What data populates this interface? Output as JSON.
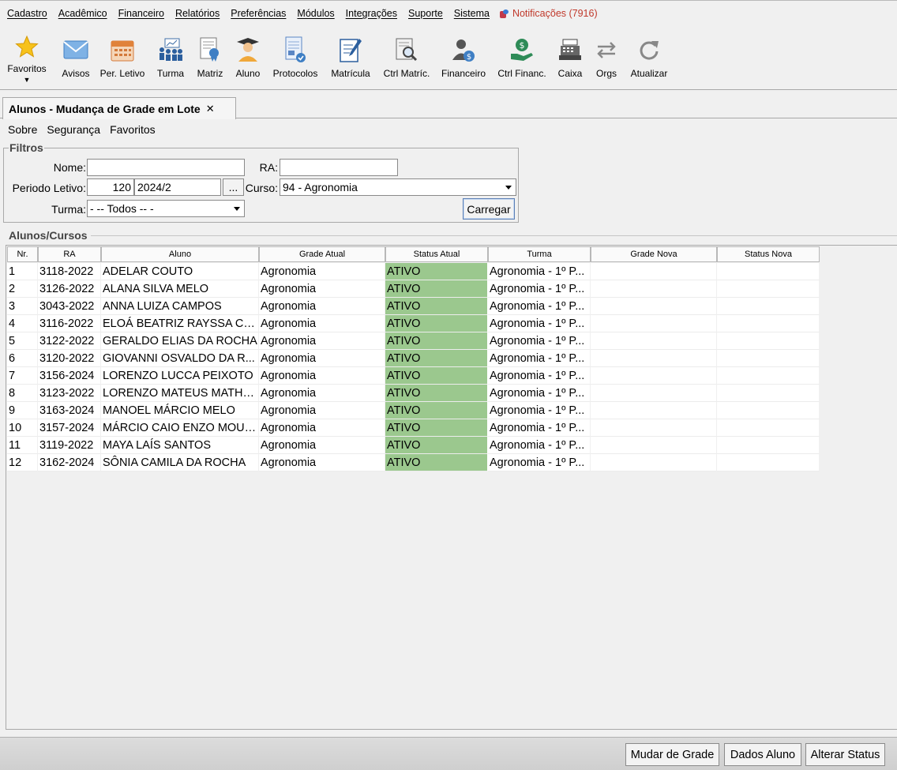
{
  "menu": {
    "items": [
      "Cadastro",
      "Acadêmico",
      "Financeiro",
      "Relatórios",
      "Preferências",
      "Módulos",
      "Integrações",
      "Suporte",
      "Sistema"
    ],
    "notifications": "Notificações (7916)"
  },
  "toolbar": {
    "favoritos": "Favoritos",
    "avisos": "Avisos",
    "per_letivo": "Per. Letivo",
    "turma": "Turma",
    "matriz": "Matriz",
    "aluno": "Aluno",
    "protocolos": "Protocolos",
    "matricula": "Matrícula",
    "ctrl_matric": "Ctrl Matríc.",
    "financeiro": "Financeiro",
    "ctrl_financ": "Ctrl Financ.",
    "caixa": "Caixa",
    "orgs": "Orgs",
    "atualizar": "Atualizar"
  },
  "tab": {
    "title": "Alunos - Mudança de Grade em Lote",
    "close": "✕"
  },
  "submenu": [
    "Sobre",
    "Segurança",
    "Favoritos"
  ],
  "filters": {
    "title": "Filtros",
    "nome_label": "Nome:",
    "nome_value": "",
    "ra_label": "RA:",
    "ra_value": "",
    "periodo_label": "Periodo Letivo:",
    "periodo_code": "120",
    "periodo_value": "2024/2",
    "periodo_btn": "...",
    "curso_label": "Curso:",
    "curso_value": "94 - Agronomia",
    "turma_label": "Turma:",
    "turma_value": "- -- Todos -- -",
    "carregar": "Carregar"
  },
  "grid": {
    "title": "Alunos/Cursos",
    "columns": [
      "Nr.",
      "RA",
      "Aluno",
      "Grade Atual",
      "Status Atual",
      "Turma",
      "Grade Nova",
      "Status Nova"
    ],
    "rows": [
      [
        "1",
        "3118-2022",
        "ADELAR COUTO",
        "Agronomia",
        "ATIVO",
        "Agronomia - 1º P...",
        "",
        ""
      ],
      [
        "2",
        "3126-2022",
        "ALANA SILVA MELO",
        "Agronomia",
        "ATIVO",
        "Agronomia - 1º P...",
        "",
        ""
      ],
      [
        "3",
        "3043-2022",
        "ANNA LUIZA CAMPOS",
        "Agronomia",
        "ATIVO",
        "Agronomia - 1º P...",
        "",
        ""
      ],
      [
        "4",
        "3116-2022",
        "ELOÁ BEATRIZ RAYSSA CAR...",
        "Agronomia",
        "ATIVO",
        "Agronomia - 1º P...",
        "",
        ""
      ],
      [
        "5",
        "3122-2022",
        "GERALDO ELIAS DA ROCHA",
        "Agronomia",
        "ATIVO",
        "Agronomia - 1º P...",
        "",
        ""
      ],
      [
        "6",
        "3120-2022",
        "GIOVANNI OSVALDO DA R...",
        "Agronomia",
        "ATIVO",
        "Agronomia - 1º P...",
        "",
        ""
      ],
      [
        "7",
        "3156-2024",
        "LORENZO LUCCA PEIXOTO",
        "Agronomia",
        "ATIVO",
        "Agronomia - 1º P...",
        "",
        ""
      ],
      [
        "8",
        "3123-2022",
        "LORENZO MATEUS MATHE...",
        "Agronomia",
        "ATIVO",
        "Agronomia - 1º P...",
        "",
        ""
      ],
      [
        "9",
        "3163-2024",
        "MANOEL MÁRCIO MELO",
        "Agronomia",
        "ATIVO",
        "Agronomia - 1º P...",
        "",
        ""
      ],
      [
        "10",
        "3157-2024",
        "MÁRCIO CAIO ENZO MOURA",
        "Agronomia",
        "ATIVO",
        "Agronomia - 1º P...",
        "",
        ""
      ],
      [
        "11",
        "3119-2022",
        "MAYA LAÍS SANTOS",
        "Agronomia",
        "ATIVO",
        "Agronomia - 1º P...",
        "",
        ""
      ],
      [
        "12",
        "3162-2024",
        "SÔNIA CAMILA DA ROCHA",
        "Agronomia",
        "ATIVO",
        "Agronomia - 1º P...",
        "",
        ""
      ]
    ],
    "status_color": "#9bc88e"
  },
  "actions": {
    "mudar_grade": "Mudar de Grade",
    "dados_aluno": "Dados Aluno",
    "alterar_status": "Alterar Status"
  }
}
